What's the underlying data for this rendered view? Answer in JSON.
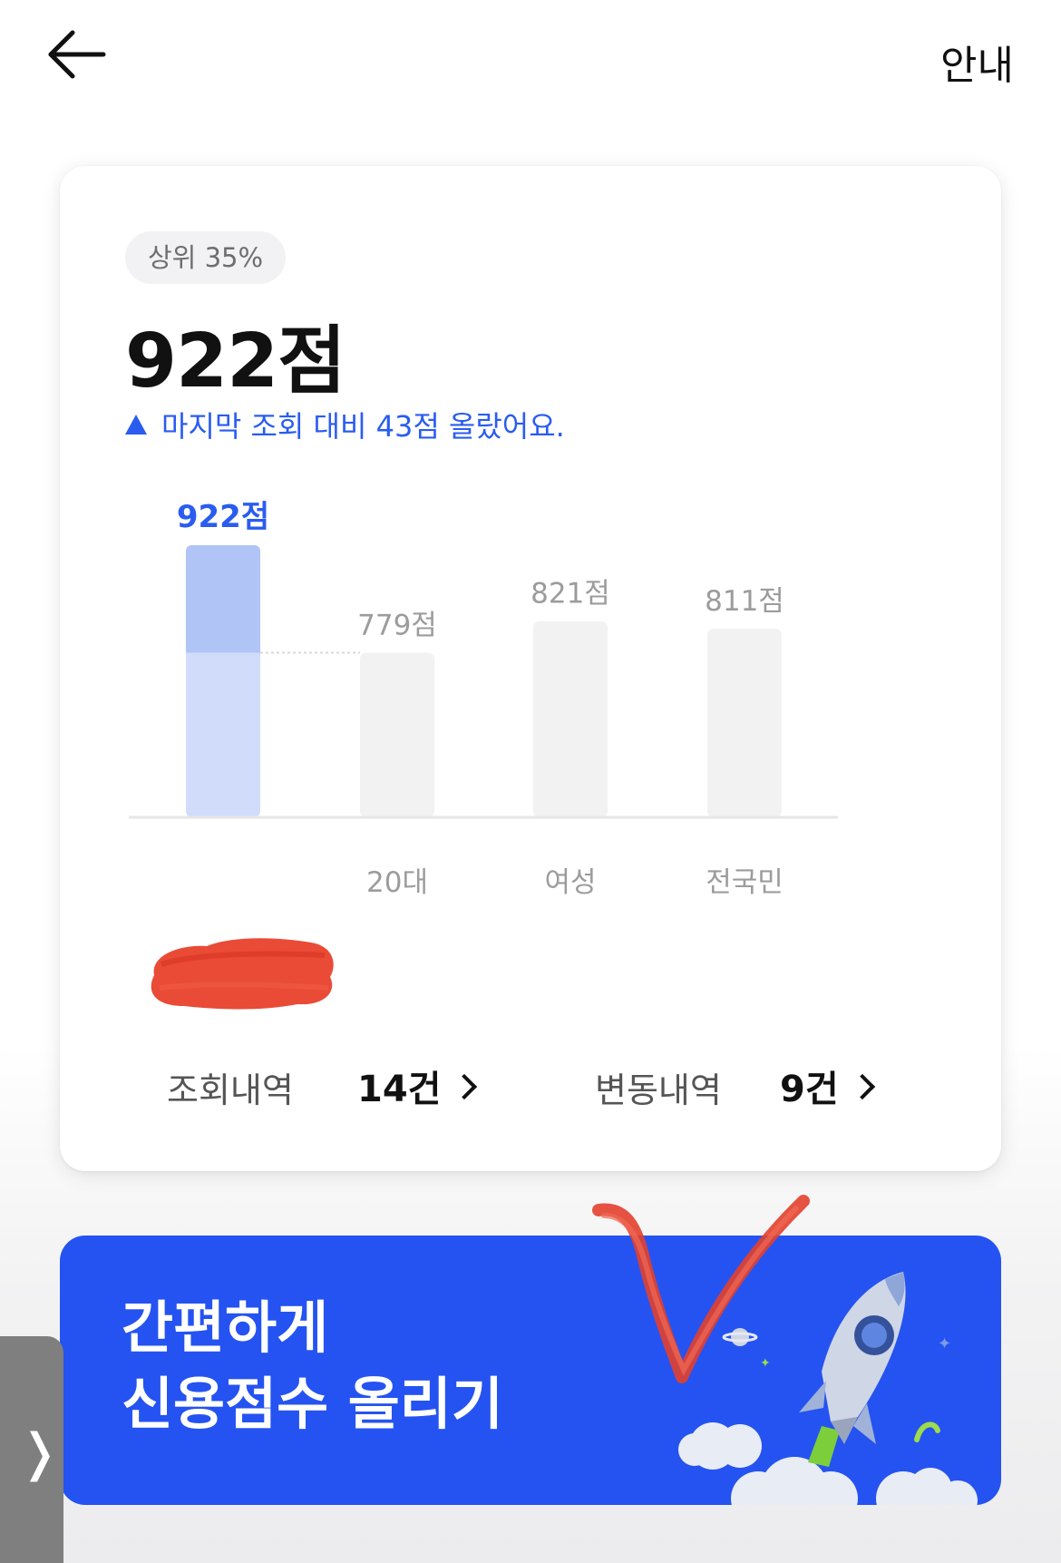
{
  "header": {
    "back_icon": "arrow-left-icon",
    "guide_label": "안내"
  },
  "score_card": {
    "rank_badge": "상위 35%",
    "score": "922점",
    "change_text": "마지막 조회 대비 43점 올랐어요.",
    "change_icon": "triangle-up-icon",
    "accent_color": "#2a5cf0"
  },
  "chart_data": {
    "type": "bar",
    "categories": [
      "",
      "20대",
      "여성",
      "전국민"
    ],
    "values": [
      922,
      779,
      821,
      811
    ],
    "value_labels": [
      "922점",
      "779점",
      "821점",
      "811점"
    ],
    "highlight_index": 0,
    "reference_value": 779,
    "colors": {
      "highlight_base": "#d1dcfb",
      "highlight_top": "#b0c4f6",
      "default": "#f2f2f2",
      "highlight_label": "#2a5cf0",
      "default_label": "#9c9c9c"
    }
  },
  "stats": {
    "inquiry_label": "조회내역",
    "inquiry_value": "14건",
    "change_label": "변동내역",
    "change_value": "9건"
  },
  "banner": {
    "line1": "간편하게",
    "line2": "신용점수 올리기",
    "background": "#2553f1",
    "illustration": "rocket-icon"
  },
  "side_tab": {
    "icon": "chevron-right-icon",
    "glyph": "❭"
  }
}
